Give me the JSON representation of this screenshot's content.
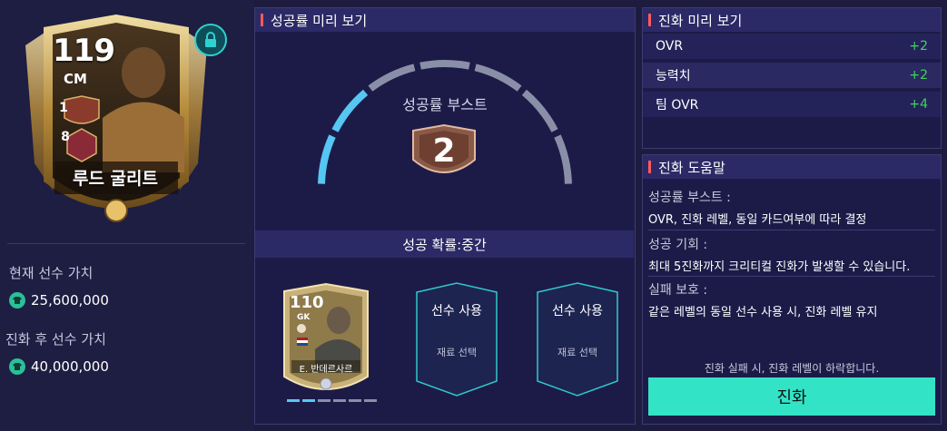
{
  "player_card": {
    "ovr": "119",
    "position": "CM",
    "rank": "1",
    "level": "8",
    "name": "루드 굴리트"
  },
  "values": {
    "current_label": "현재 선수 가치",
    "current_value": "25,600,000",
    "after_label": "진화 후 선수 가치",
    "after_value": "40,000,000"
  },
  "success_preview": {
    "title": "성공률 미리 보기",
    "boost_label": "성공률 부스트",
    "boost_value": "2",
    "chance_text": "성공 확률:중간",
    "gauge_segments_total": 7,
    "gauge_segments_filled": 2
  },
  "material_card": {
    "ovr": "110",
    "position": "GK",
    "name": "E. 반데르사르",
    "pips_filled": 2,
    "pips_total": 6
  },
  "slots": [
    {
      "title": "선수 사용",
      "sub": "재료 선택"
    },
    {
      "title": "선수 사용",
      "sub": "재료 선택"
    }
  ],
  "evo_preview": {
    "title": "진화 미리 보기",
    "rows": [
      {
        "label": "OVR",
        "value": "+2"
      },
      {
        "label": "능력치",
        "value": "+2"
      },
      {
        "label": "팀 OVR",
        "value": "+4"
      }
    ]
  },
  "help": {
    "title": "진화 도움말",
    "items": [
      {
        "title": "성공률 부스트 :",
        "desc": "OVR, 진화 레벨, 동일 카드여부에 따라 결정"
      },
      {
        "title": "성공 기회 :",
        "desc": "최대 5진화까지 크리티컬 진화가 발생할 수 있습니다."
      },
      {
        "title": "실패 보호 :",
        "desc": "같은 레벨의 동일 선수 사용 시, 진화 레벨 유지"
      }
    ],
    "fail_note": "진화 실패 시, 진화 레벨이 하락합니다.",
    "evolve_button": "진화"
  },
  "colors": {
    "accent_teal": "#32e3c6",
    "positive_green": "#42d35a",
    "gauge_active": "#56c6f2",
    "gauge_inactive": "#8a8fa8",
    "panel_header": "#2b2a66",
    "title_bar_red": "#ff5a5a"
  }
}
